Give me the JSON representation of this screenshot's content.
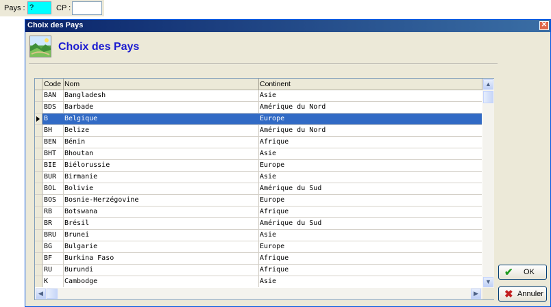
{
  "filter": {
    "pays_label": "Pays :",
    "pays_value": "?",
    "cp_label": "CP :",
    "cp_value": ""
  },
  "window": {
    "title": "Choix des Pays",
    "close_glyph": "✕",
    "heading": "Choix des Pays"
  },
  "grid": {
    "columns": {
      "code": "Code",
      "nom": "Nom",
      "continent": "Continent"
    },
    "rows": [
      {
        "code": "BAN",
        "nom": "Bangladesh",
        "continent": "Asie"
      },
      {
        "code": "BDS",
        "nom": "Barbade",
        "continent": "Amérique du Nord"
      },
      {
        "code": "B",
        "nom": "Belgique",
        "continent": "Europe"
      },
      {
        "code": "BH",
        "nom": "Belize",
        "continent": "Amérique du Nord"
      },
      {
        "code": "BEN",
        "nom": "Bénin",
        "continent": "Afrique"
      },
      {
        "code": "BHT",
        "nom": "Bhoutan",
        "continent": "Asie"
      },
      {
        "code": "BIE",
        "nom": "Biélorussie",
        "continent": "Europe"
      },
      {
        "code": "BUR",
        "nom": "Birmanie",
        "continent": "Asie"
      },
      {
        "code": "BOL",
        "nom": "Bolivie",
        "continent": "Amérique du Sud"
      },
      {
        "code": "BOS",
        "nom": "Bosnie-Herzégovine",
        "continent": "Europe"
      },
      {
        "code": "RB",
        "nom": "Botswana",
        "continent": "Afrique"
      },
      {
        "code": "BR",
        "nom": "Brésil",
        "continent": "Amérique du Sud"
      },
      {
        "code": "BRU",
        "nom": "Brunei",
        "continent": "Asie"
      },
      {
        "code": "BG",
        "nom": "Bulgarie",
        "continent": "Europe"
      },
      {
        "code": "BF",
        "nom": "Burkina Faso",
        "continent": "Afrique"
      },
      {
        "code": "RU",
        "nom": "Burundi",
        "continent": "Afrique"
      },
      {
        "code": "K",
        "nom": "Cambodge",
        "continent": "Asie"
      }
    ],
    "selected_index": 2
  },
  "buttons": {
    "ok_label": "OK",
    "ok_icon": "checkmark-icon",
    "cancel_label": "Annuler",
    "cancel_icon": "cross-icon"
  },
  "colors": {
    "selection": "#316ac5",
    "pays_field": "#00ffff",
    "heading": "#1a1ad0"
  }
}
